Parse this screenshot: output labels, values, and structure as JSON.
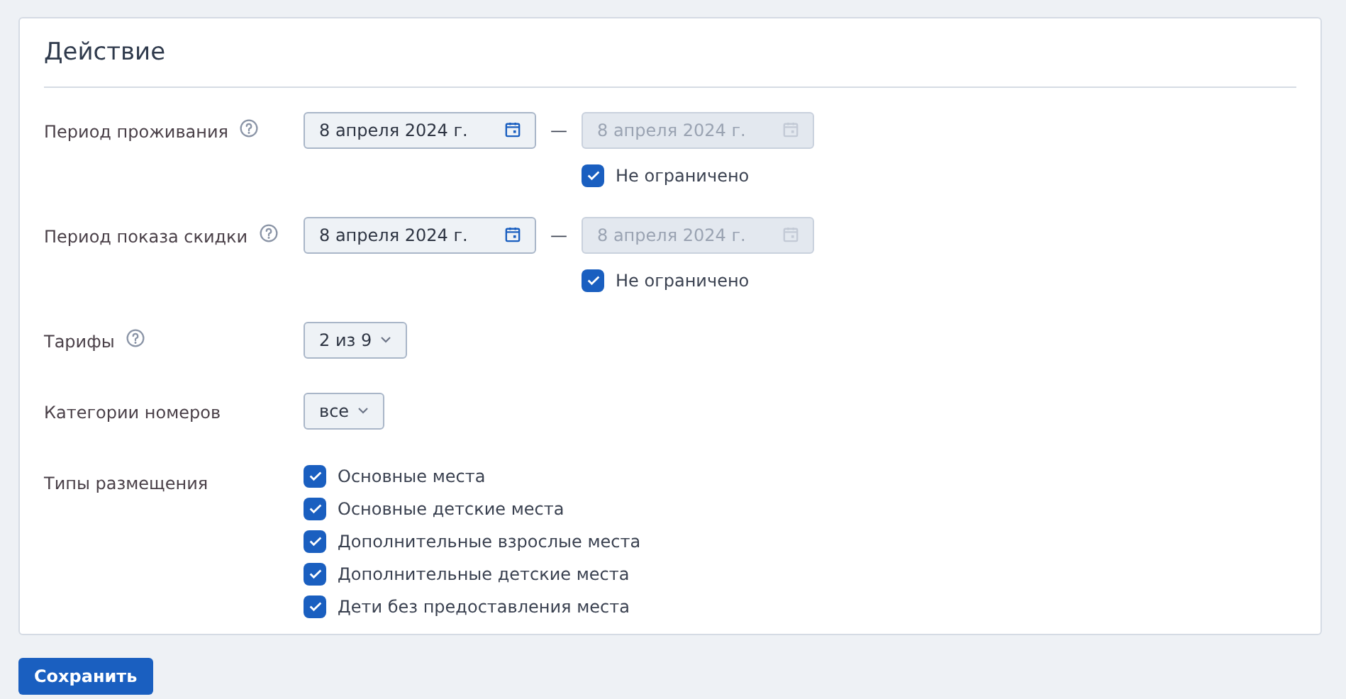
{
  "title": "Действие",
  "rows": [
    {
      "kind": "date_range",
      "label": "Период проживания",
      "help": true,
      "from": {
        "value": "8 апреля 2024 г.",
        "disabled": false
      },
      "to": {
        "value": "8 апреля 2024 г.",
        "disabled": true
      },
      "dash": "—",
      "unlimited": {
        "label": "Не ограничено",
        "checked": true
      }
    },
    {
      "kind": "date_range",
      "label": "Период показа скидки",
      "help": true,
      "from": {
        "value": "8 апреля 2024 г.",
        "disabled": false
      },
      "to": {
        "value": "8 апреля 2024 г.",
        "disabled": true
      },
      "dash": "—",
      "unlimited": {
        "label": "Не ограничено",
        "checked": true
      }
    },
    {
      "kind": "select",
      "label": "Тарифы",
      "help": true,
      "value": "2 из 9"
    },
    {
      "kind": "select",
      "label": "Категории номеров",
      "help": false,
      "value": "все"
    },
    {
      "kind": "checkboxes",
      "label": "Типы размещения",
      "help": false,
      "options": [
        {
          "label": "Основные места",
          "checked": true
        },
        {
          "label": "Основные детские места",
          "checked": true
        },
        {
          "label": "Дополнительные взрослые места",
          "checked": true
        },
        {
          "label": "Дополнительные детские места",
          "checked": true
        },
        {
          "label": "Дети без предоставления места",
          "checked": true
        }
      ]
    }
  ],
  "save_button": "Сохранить"
}
